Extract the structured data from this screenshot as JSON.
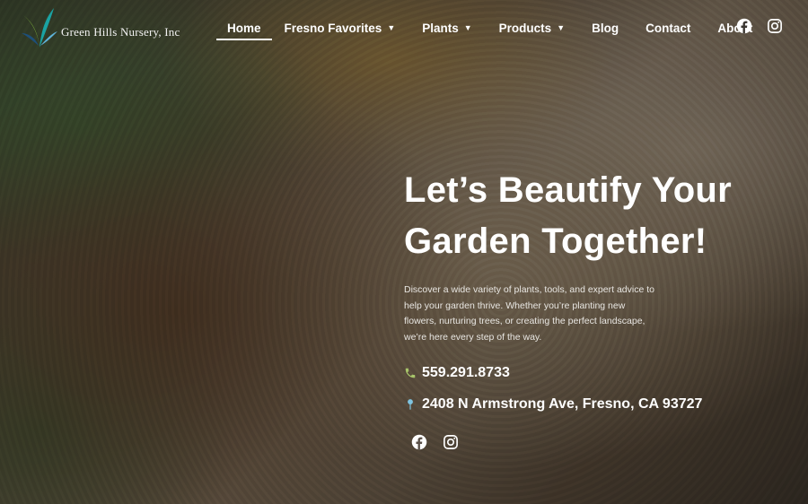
{
  "brand": {
    "name": "Green Hills Nursery, Inc"
  },
  "nav": {
    "items": [
      {
        "label": "Home",
        "active": true,
        "dropdown": false
      },
      {
        "label": "Fresno Favorites",
        "active": false,
        "dropdown": true
      },
      {
        "label": "Plants",
        "active": false,
        "dropdown": true
      },
      {
        "label": "Products",
        "active": false,
        "dropdown": true
      },
      {
        "label": "Blog",
        "active": false,
        "dropdown": false
      },
      {
        "label": "Contact",
        "active": false,
        "dropdown": false
      },
      {
        "label": "About",
        "active": false,
        "dropdown": false
      }
    ]
  },
  "header_social": [
    "facebook-icon",
    "instagram-icon"
  ],
  "hero": {
    "title_line1": "Let’s Beautify Your",
    "title_line2": "Garden Together!",
    "description": "Discover a wide variety of plants, tools, and expert advice to help your garden thrive. Whether you’re planting new flowers, nurturing trees, or creating the perfect landscape, we’re here every step of the way.",
    "phone": "559.291.8733",
    "address": "2408 N Armstrong Ave, Fresno, CA 93727",
    "social": [
      "facebook-icon",
      "instagram-icon"
    ]
  },
  "colors": {
    "phone_icon": "#a7c46a",
    "location_icon": "#7fc4e0",
    "logo_teal": "#1aa3a3",
    "logo_green": "#8cc63f",
    "logo_navy": "#1d4f7a"
  }
}
